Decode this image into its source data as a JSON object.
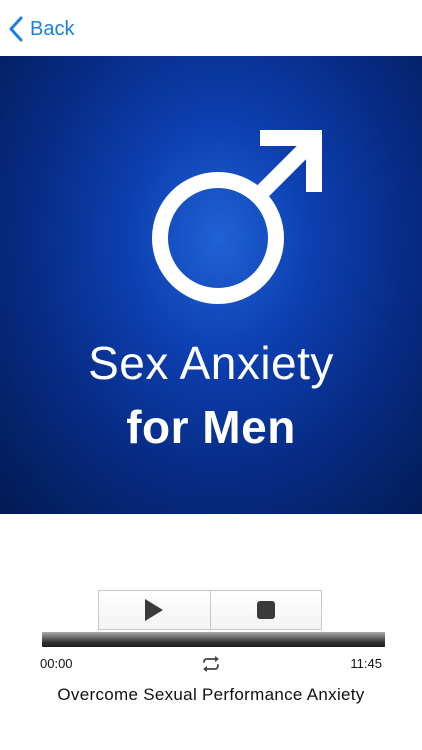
{
  "nav": {
    "back_label": "Back",
    "back_icon": "chevron-left-icon"
  },
  "artwork": {
    "line1": "Sex Anxiety",
    "line2": "for Men",
    "symbol_icon": "male-symbol-icon"
  },
  "player": {
    "play_icon": "play-icon",
    "stop_icon": "stop-icon",
    "repeat_icon": "repeat-icon",
    "elapsed": "00:00",
    "duration": "11:45",
    "progress": 0,
    "track_title": "Overcome Sexual Performance Anxiety"
  },
  "colors": {
    "accent": "#1a7fe0",
    "artwork_center": "#1f63d6",
    "artwork_edge": "#031a52"
  }
}
